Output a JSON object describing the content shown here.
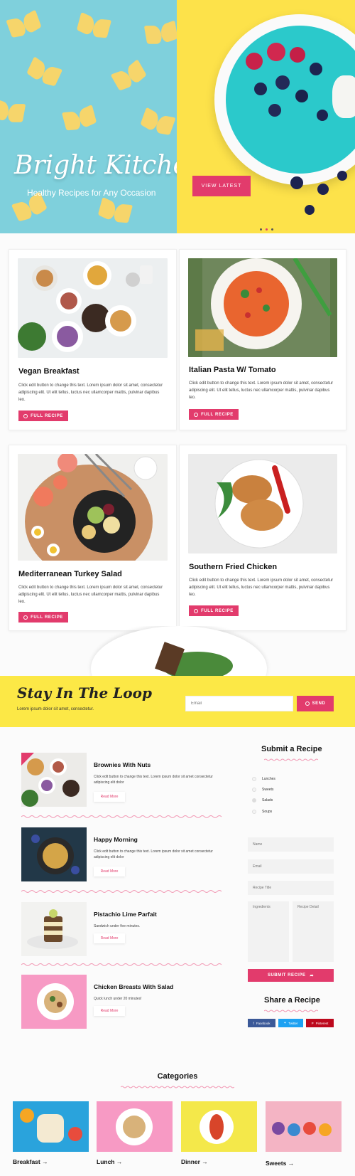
{
  "hero": {
    "brand": "Bright Kitchen",
    "tagline": "Healthy Recipes for Any Occasion",
    "cta": "VIEW LATEST",
    "slide_count": 3,
    "colors": {
      "left_bg": "#7fd0dc",
      "right_bg": "#fde24a",
      "accent": "#e23b6c"
    }
  },
  "cards": [
    {
      "title": "Vegan Breakfast",
      "text": "Click edit button to change this text. Lorem ipsum dolor sit amet, consectetur adipiscing elit. Ut elit tellus, luctus nec ullamcorper mattis, pulvinar dapibus leo.",
      "button": "FULL RECIPE"
    },
    {
      "title": "Italian Pasta W/ Tomato",
      "text": "Click edit button to change this text. Lorem ipsum dolor sit amet, consectetur adipiscing elit. Ut elit tellus, luctus nec ullamcorper mattis, pulvinar dapibus leo.",
      "button": "FULL RECIPE"
    },
    {
      "title": "Mediterranean Turkey Salad",
      "text": "Click edit button to change this text. Lorem ipsum dolor sit amet, consectetur adipiscing elit. Ut elit tellus, luctus nec ullamcorper mattis, pulvinar dapibus leo.",
      "button": "FULL RECIPE"
    },
    {
      "title": "Southern Fried Chicken",
      "text": "Click edit button to change this text. Lorem ipsum dolor sit amet, consectetur adipiscing elit. Ut elit tellus, luctus nec ullamcorper mattis, pulvinar dapibus leo.",
      "button": "FULL RECIPE"
    }
  ],
  "newsletter": {
    "title": "Stay In The Loop",
    "subtitle": "Lorem ipsum dolor sit amet, consectetur.",
    "email_placeholder": "Email",
    "send": "SEND"
  },
  "recipes": [
    {
      "title": "Brownies With Nuts",
      "desc": "Click edit button to change this text. Lorem ipsum dolor sit amet consectetur adipiscing elit dolor",
      "read_more": "Read More"
    },
    {
      "title": "Happy Morning",
      "desc": "Click edit button to change this text. Lorem ipsum dolor sit amet consectetur adipiscing elit dolor",
      "read_more": "Read More"
    },
    {
      "title": "Pistachio Lime Parfait",
      "desc": "Sandwich under five minutes.",
      "read_more": "Read More"
    },
    {
      "title": "Chicken Breasts With Salad",
      "desc": "Quick lunch under 20 minutes!",
      "read_more": "Read More"
    }
  ],
  "submit_form": {
    "title": "Submit a Recipe",
    "options": [
      "Lunches",
      "Sweets",
      "Salads",
      "Soups"
    ],
    "selected": "Salads",
    "name_placeholder": "Name",
    "email_placeholder": "Email",
    "recipe_title_placeholder": "Recipe Title",
    "ingredients_placeholder": "Ingredients",
    "detail_placeholder": "Recipe Detail",
    "submit": "SUBMIT RECIPE"
  },
  "share": {
    "title": "Share a Recipe",
    "buttons": [
      {
        "label": "Facebook",
        "icon": "facebook-icon",
        "color": "#3b5998"
      },
      {
        "label": "Twitter",
        "icon": "twitter-icon",
        "color": "#1da1f2"
      },
      {
        "label": "Pinterest",
        "icon": "pinterest-icon",
        "color": "#bd081c"
      }
    ]
  },
  "categories": {
    "title": "Categories",
    "items": [
      "Breakfast →",
      "Lunch →",
      "Dinner →",
      "Sweets →"
    ]
  }
}
